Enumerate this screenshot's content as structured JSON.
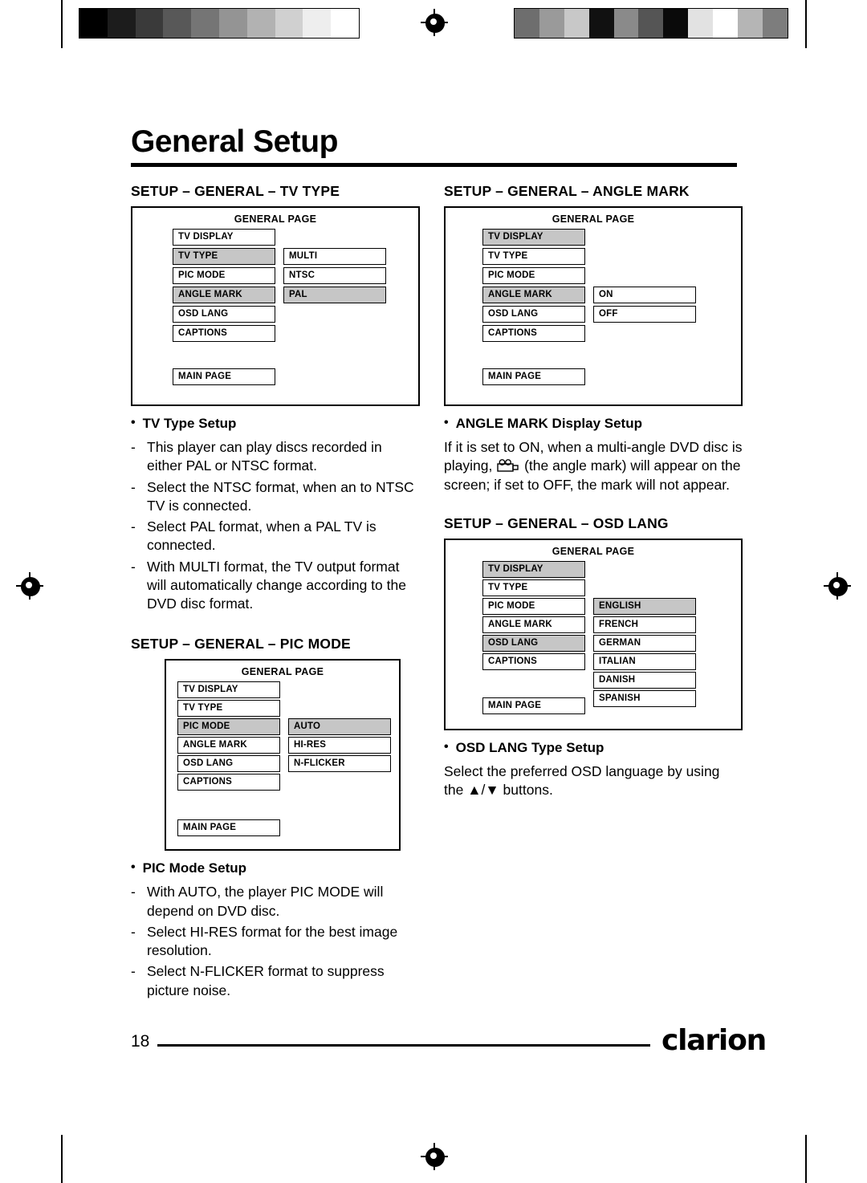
{
  "page": {
    "title": "General Setup",
    "number": "18",
    "brand": "clarion"
  },
  "sections": {
    "tv_type": {
      "heading": "SETUP – GENERAL – TV TYPE",
      "osd": {
        "title": "GENERAL PAGE",
        "left_items": [
          "TV DISPLAY",
          "TV TYPE",
          "PIC MODE",
          "ANGLE MARK",
          "OSD LANG",
          "CAPTIONS"
        ],
        "highlighted_left": "TV TYPE",
        "right_items": [
          "MULTI",
          "NTSC",
          "PAL"
        ],
        "right_start_row": 1,
        "main_page": "MAIN PAGE"
      },
      "bullet": "TV Type Setup",
      "dashes": [
        "This player can play discs recorded in either PAL or NTSC format.",
        "Select the NTSC format, when an to NTSC TV is connected.",
        "Select PAL format, when a PAL TV is connected.",
        "With MULTI format, the TV output format will automatically change according to the DVD disc format."
      ]
    },
    "pic_mode": {
      "heading": "SETUP – GENERAL – PIC MODE",
      "osd": {
        "title": "GENERAL PAGE",
        "left_items": [
          "TV DISPLAY",
          "TV TYPE",
          "PIC MODE",
          "ANGLE MARK",
          "OSD LANG",
          "CAPTIONS"
        ],
        "highlighted_left": "PIC MODE",
        "right_items": [
          "AUTO",
          "HI-RES",
          "N-FLICKER"
        ],
        "right_start_row": 2,
        "main_page": "MAIN PAGE"
      },
      "bullet": "PIC Mode Setup",
      "dashes": [
        "With AUTO, the player PIC MODE will depend on DVD disc.",
        "Select HI-RES format for the best image resolution.",
        "Select N-FLICKER format to suppress picture noise."
      ]
    },
    "angle_mark": {
      "heading": "SETUP – GENERAL – ANGLE MARK",
      "osd": {
        "title": "GENERAL PAGE",
        "left_items": [
          "TV DISPLAY",
          "TV TYPE",
          "PIC MODE",
          "ANGLE MARK",
          "OSD LANG",
          "CAPTIONS"
        ],
        "highlighted_left": "ANGLE MARK",
        "right_items": [
          "ON",
          "OFF"
        ],
        "right_start_row": 3,
        "main_page": "MAIN PAGE"
      },
      "bullet": "ANGLE MARK Display Setup",
      "body_part1": "If it is set to ON, when a multi-angle DVD disc is playing,",
      "body_part2": "(the angle mark) will appear on the screen; if set to OFF, the mark will not appear."
    },
    "osd_lang": {
      "heading": "SETUP – GENERAL – OSD LANG",
      "osd": {
        "title": "GENERAL PAGE",
        "left_items": [
          "TV DISPLAY",
          "TV TYPE",
          "PIC MODE",
          "ANGLE MARK",
          "OSD LANG",
          "CAPTIONS"
        ],
        "highlighted_left": "OSD LANG",
        "right_items": [
          "ENGLISH",
          "FRENCH",
          "GERMAN",
          "ITALIAN",
          "DANISH",
          "SPANISH"
        ],
        "highlighted_right": "ENGLISH",
        "right_start_row": 2,
        "main_page": "MAIN PAGE"
      },
      "bullet": "OSD LANG Type Setup",
      "body": "Select the preferred OSD language by using the ▲/▼ buttons."
    }
  },
  "calibration": {
    "top_left_bar": [
      "#000000",
      "#1c1c1c",
      "#3a3a3a",
      "#585858",
      "#757575",
      "#949494",
      "#b2b2b2",
      "#d0d0d0",
      "#eeeeee",
      "#ffffff"
    ],
    "top_right_bar": [
      "#6e6e6e",
      "#9a9a9a",
      "#c8c8c8",
      "#111111",
      "#8a8a8a",
      "#555555",
      "#0a0a0a",
      "#e2e2e2",
      "#ffffff",
      "#b5b5b5",
      "#7d7d7d"
    ]
  }
}
